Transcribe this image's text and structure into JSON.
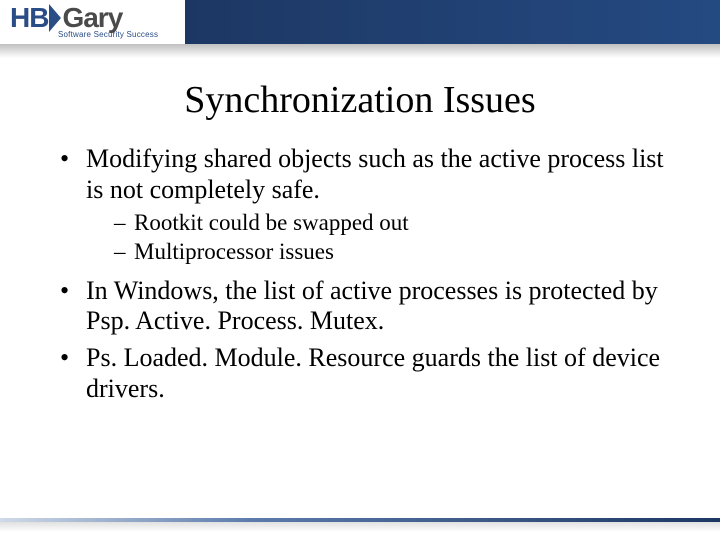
{
  "header": {
    "logo_hb": "HB",
    "logo_gary": "Gary",
    "tagline": "Software Security Success"
  },
  "title": "Synchronization Issues",
  "bullets": [
    {
      "text": "Modifying shared objects such as the active process list is not completely safe.",
      "sub": [
        "Rootkit could be swapped out",
        "Multiprocessor issues"
      ]
    },
    {
      "text": "In Windows, the list of active processes is protected by Psp. Active. Process. Mutex.",
      "sub": []
    },
    {
      "text": "Ps. Loaded. Module. Resource guards the list of device drivers.",
      "sub": []
    }
  ]
}
